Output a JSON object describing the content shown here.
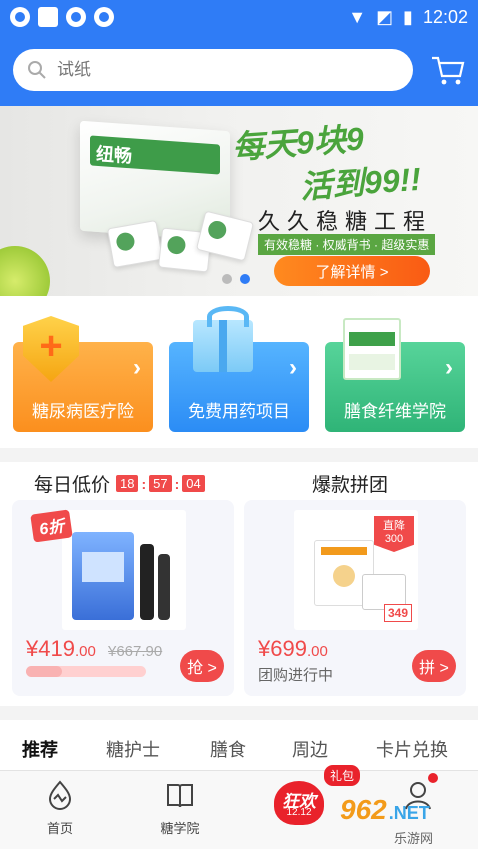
{
  "status_bar": {
    "time": "12:02"
  },
  "search": {
    "placeholder": "试纸"
  },
  "banner": {
    "product_name": "纽畅",
    "slogan_line1": "每天9块9",
    "slogan_line2": "活到99!!",
    "title": "久久稳糖工程",
    "subtitle": "有效稳糖 · 权威背书 · 超级实惠",
    "button_label": "了解详情 >",
    "active_slide": 2,
    "slide_count": 2
  },
  "services": [
    {
      "label": "糖尿病医疗险"
    },
    {
      "label": "免费用药项目"
    },
    {
      "label": "膳食纤维学院"
    }
  ],
  "daily_deal": {
    "heading": "每日低价",
    "timer": {
      "hh": "18",
      "mm": "57",
      "ss": "04"
    },
    "badge": "6折",
    "price_int": "¥419",
    "price_dec": ".00",
    "old_price": "¥667.90",
    "grab_label": "抢 >",
    "progress": 0.3
  },
  "group_deal": {
    "heading": "爆款拼团",
    "discount_badge": "直降 300",
    "tag_price": "349",
    "price_int": "¥699",
    "price_dec": ".00",
    "status": "团购进行中",
    "join_label": "拼 >"
  },
  "tabs": [
    "推荐",
    "糖护士",
    "膳食",
    "周边",
    "卡片兑换"
  ],
  "bottom_nav": {
    "home": "首页",
    "school": "糖学院",
    "promo_main": "狂欢",
    "promo_date": "12.12",
    "gift_bubble": "礼包"
  },
  "watermark": {
    "num": "962",
    "net": ".NET",
    "sub": "乐游网"
  },
  "colors": {
    "primary": "#2f7cf6",
    "accent": "#f04a4a",
    "orange": "#fb8f1e",
    "green": "#2fb477"
  }
}
